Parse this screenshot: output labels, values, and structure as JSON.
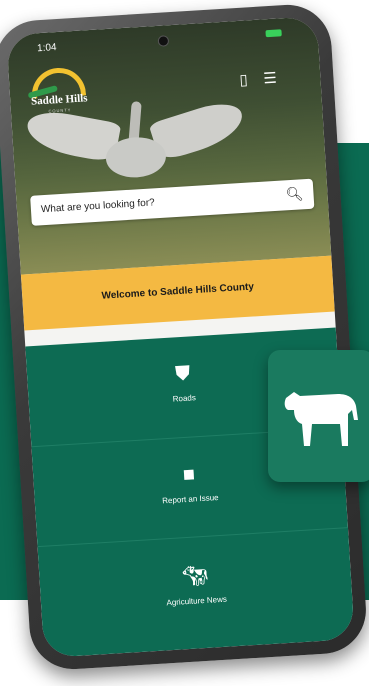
{
  "status": {
    "time": "1:04"
  },
  "header": {
    "logo_name": "Saddle Hills",
    "logo_sub": "COUNTY"
  },
  "search": {
    "placeholder": "What are you looking for?"
  },
  "welcome": "Welcome to Saddle Hills County",
  "tiles": [
    {
      "label": "Roads",
      "icon": "road-sign-icon"
    },
    {
      "label": "Report an Issue",
      "icon": "report-icon"
    },
    {
      "label": "Agriculture News",
      "icon": "cow-icon"
    }
  ],
  "colors": {
    "green": "#0b6b52",
    "yellow": "#f4b942"
  }
}
